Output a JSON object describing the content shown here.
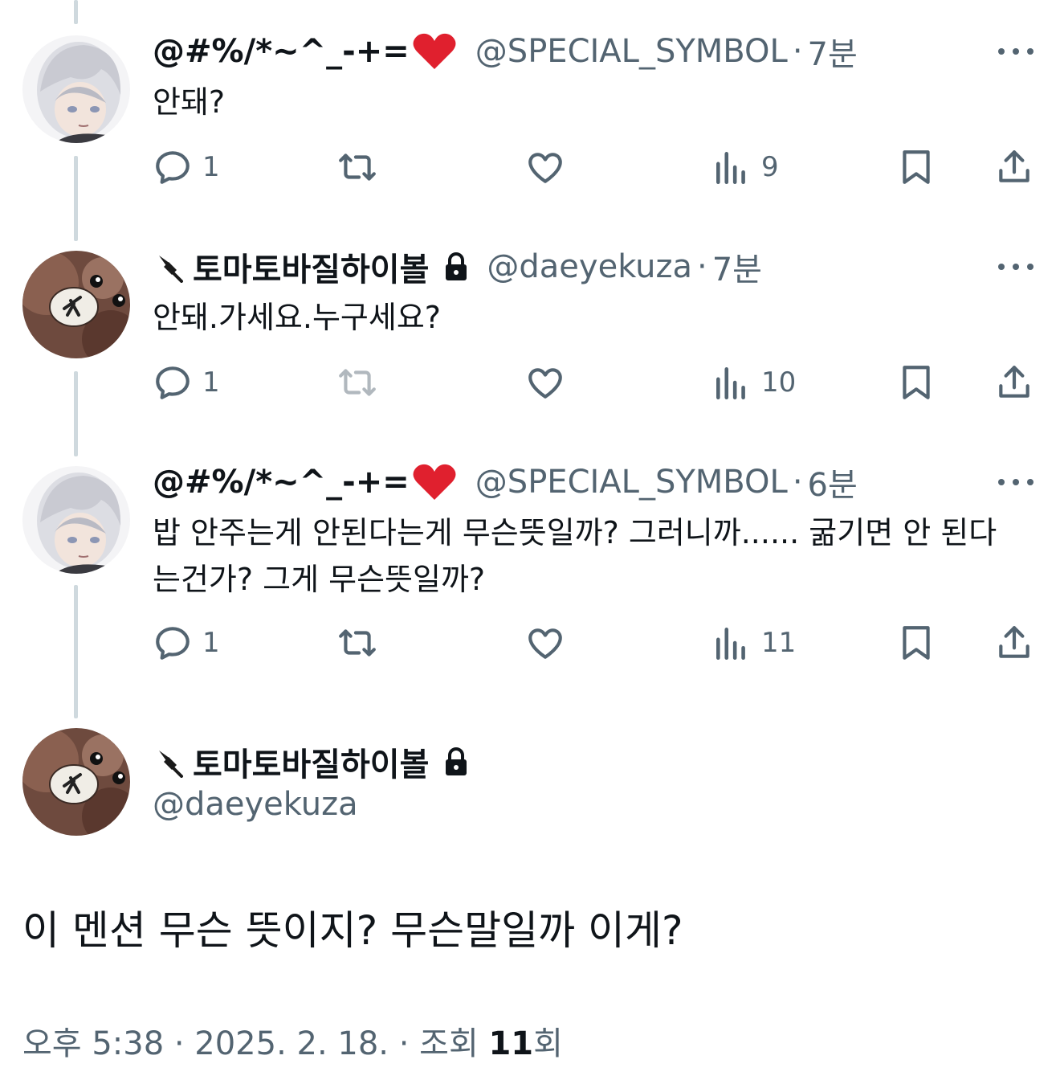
{
  "colors": {
    "text": "#0f1419",
    "secondary": "#536471",
    "thread_line": "#cfd9de",
    "heart_emoji": "#e0202e"
  },
  "tweets": [
    {
      "name": "@#%/*~^_-+=",
      "name_emoji": "heart-emoji",
      "handle": "@SPECIAL_SYMBOL",
      "sep": "·",
      "time": "7분",
      "text": "안돼?",
      "replies": "1",
      "views": "9",
      "avatar": "white-hair-anime-avatar"
    },
    {
      "name": "토마토바질하이볼",
      "name_prefix_icon": "pin-icon",
      "protected": true,
      "handle": "@daeyekuza",
      "sep": "·",
      "time": "7분",
      "text": "안돼.가세요.누구세요?",
      "replies": "1",
      "views": "10",
      "avatar": "stuffed-bear-avatar",
      "retweet_disabled": true
    },
    {
      "name": "@#%/*~^_-+=",
      "name_emoji": "heart-emoji",
      "handle": "@SPECIAL_SYMBOL",
      "sep": "·",
      "time": "6분",
      "text": "밥 안주는게 안된다는게 무슨뜻일까? 그러니까...... 굶기면 안 된다는건가? 그게 무슨뜻일까?",
      "replies": "1",
      "views": "11",
      "avatar": "white-hair-anime-avatar"
    }
  ],
  "main_tweet": {
    "name": "토마토바질하이볼",
    "name_prefix_icon": "pin-icon",
    "protected": true,
    "handle": "@daeyekuza",
    "text": "이 멘션 무슨 뜻이지? 무슨말일까 이게?",
    "meta_prefix": "오후 5:38 · 2025. 2. 18. · 조회 ",
    "views": "11",
    "views_suffix": "회",
    "avatar": "stuffed-bear-avatar"
  }
}
